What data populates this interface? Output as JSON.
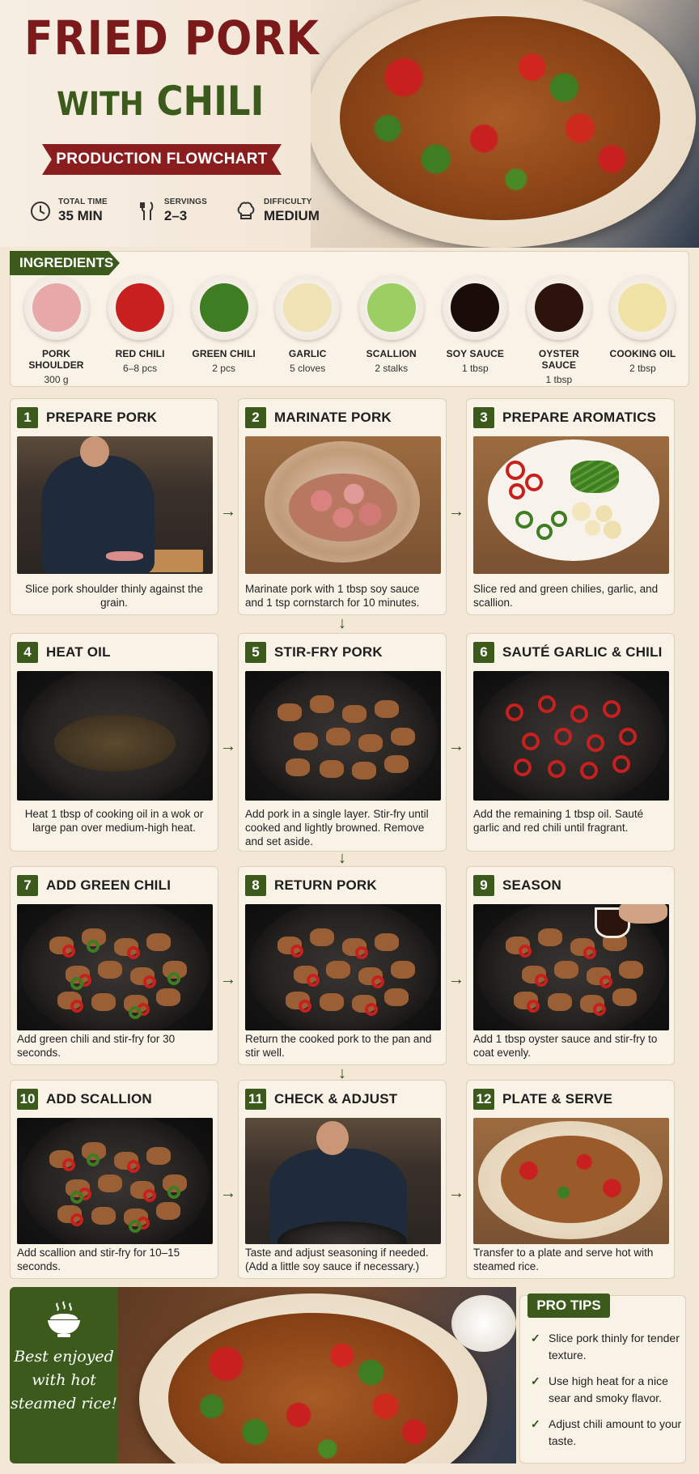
{
  "header": {
    "title_line1": "FRIED PORK",
    "title_with": "WITH",
    "title_chili": "CHILI",
    "subtitle": "PRODUCTION FLOWCHART",
    "stats": [
      {
        "label": "TOTAL TIME",
        "value": "35 MIN",
        "icon": "clock-icon"
      },
      {
        "label": "SERVINGS",
        "value": "2–3",
        "icon": "fork-knife-icon"
      },
      {
        "label": "DIFFICULTY",
        "value": "MEDIUM",
        "icon": "chef-hat-icon"
      }
    ]
  },
  "ingredients": {
    "label": "INGREDIENTS",
    "items": [
      {
        "name": "PORK SHOULDER",
        "qty": "300 g",
        "color": "#e7a9a7"
      },
      {
        "name": "RED CHILI",
        "qty": "6–8 pcs",
        "color": "#c8201e"
      },
      {
        "name": "GREEN CHILI",
        "qty": "2 pcs",
        "color": "#3e7d22"
      },
      {
        "name": "GARLIC",
        "qty": "5 cloves",
        "color": "#efe2b4"
      },
      {
        "name": "SCALLION",
        "qty": "2 stalks",
        "color": "#9ccf63"
      },
      {
        "name": "SOY SAUCE",
        "qty": "1 tbsp",
        "color": "#1a0d08"
      },
      {
        "name": "OYSTER SAUCE",
        "qty": "1 tbsp",
        "color": "#2c140c"
      },
      {
        "name": "COOKING OIL",
        "qty": "2 tbsp",
        "color": "#f1e3a6"
      }
    ]
  },
  "steps": [
    {
      "num": "1",
      "title": "PREPARE PORK",
      "desc": "Slice pork shoulder thinly against the grain."
    },
    {
      "num": "2",
      "title": "MARINATE PORK",
      "desc": "Marinate pork with 1 tbsp soy sauce and 1 tsp cornstarch for 10 minutes."
    },
    {
      "num": "3",
      "title": "PREPARE AROMATICS",
      "desc": "Slice red and green chilies, garlic, and scallion."
    },
    {
      "num": "4",
      "title": "HEAT OIL",
      "desc": "Heat 1 tbsp of cooking oil in a wok or large pan over medium-high heat."
    },
    {
      "num": "5",
      "title": "STIR-FRY PORK",
      "desc": "Add pork in a single layer. Stir-fry until cooked and lightly browned. Remove and set aside."
    },
    {
      "num": "6",
      "title": "SAUTÉ GARLIC & CHILI",
      "desc": "Add the remaining 1 tbsp oil. Sauté garlic and red chili until fragrant."
    },
    {
      "num": "7",
      "title": "ADD GREEN CHILI",
      "desc": "Add green chili and stir-fry for 30 seconds."
    },
    {
      "num": "8",
      "title": "RETURN PORK",
      "desc": "Return the cooked pork to the pan and stir well."
    },
    {
      "num": "9",
      "title": "SEASON",
      "desc": "Add 1 tbsp oyster sauce and stir-fry to coat evenly."
    },
    {
      "num": "10",
      "title": "ADD SCALLION",
      "desc": "Add scallion and stir-fry for 10–15 seconds."
    },
    {
      "num": "11",
      "title": "CHECK & ADJUST",
      "desc": "Taste and adjust seasoning if needed. (Add a little soy sauce if necessary.)"
    },
    {
      "num": "12",
      "title": "PLATE & SERVE",
      "desc": "Transfer to a plate and serve hot with steamed rice."
    }
  ],
  "footer": {
    "serving_note": "Best enjoyed with hot steamed rice!",
    "tips_label": "PRO TIPS",
    "tips": [
      "Slice pork thinly for tender texture.",
      "Use high heat for a nice sear and smoky flavor.",
      "Adjust chili amount to your taste."
    ]
  },
  "colors": {
    "dark_red": "#7a1a1a",
    "ribbon_red": "#8a1e1e",
    "herb_green": "#3c5a1c",
    "cream": "#f9f2e7"
  }
}
